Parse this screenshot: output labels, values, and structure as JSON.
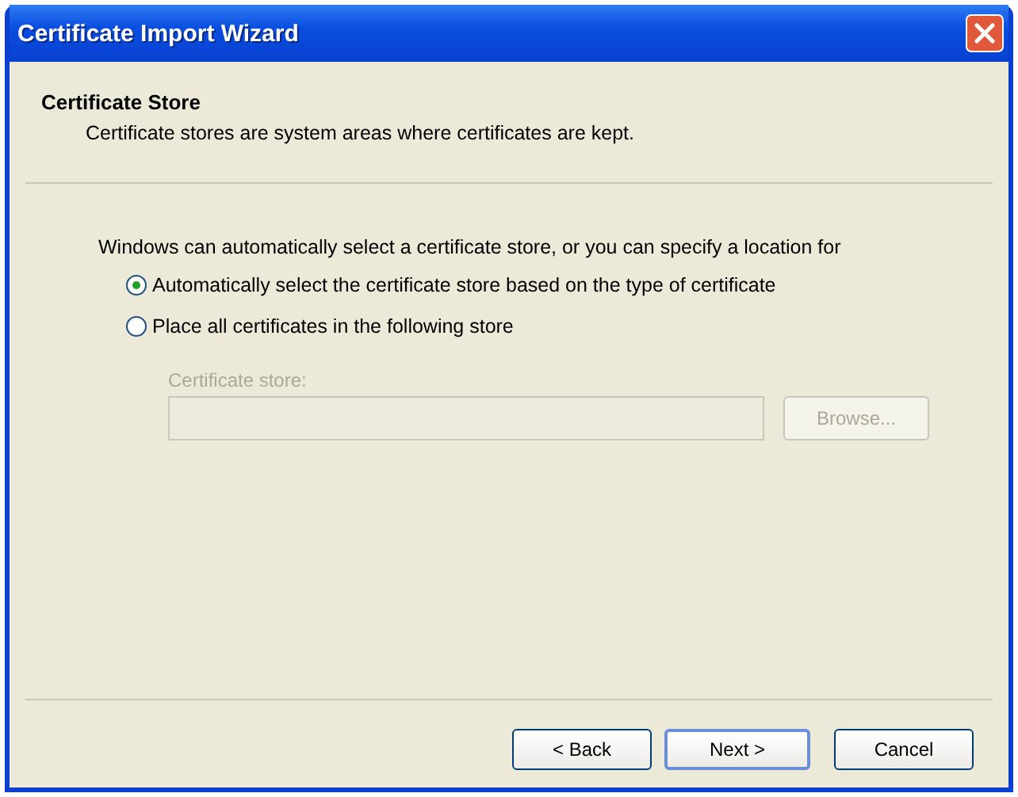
{
  "window": {
    "title": "Certificate Import Wizard"
  },
  "header": {
    "title": "Certificate Store",
    "subtitle": "Certificate stores are system areas where certificates are kept."
  },
  "intro": "Windows can automatically select a certificate store, or you can specify a location for",
  "options": [
    {
      "label": "Automatically select the certificate store based on the type of certificate",
      "selected": true
    },
    {
      "label": "Place all certificates in the following store",
      "selected": false
    }
  ],
  "store_field": {
    "label": "Certificate store:",
    "disabled": true
  },
  "browse": {
    "label": "Browse...",
    "disabled": true
  },
  "buttons": [
    {
      "label": "< Back",
      "default": false
    },
    {
      "label": "Next >",
      "default": true
    },
    {
      "label": "Cancel",
      "default": false
    }
  ]
}
